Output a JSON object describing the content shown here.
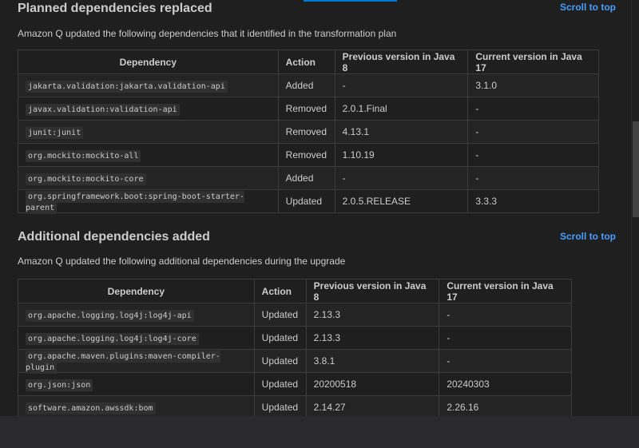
{
  "planned": {
    "title": "Planned dependencies replaced",
    "scroll_label": "Scroll to top",
    "description": "Amazon Q updated the following dependencies that it identified in the transformation plan",
    "columns": [
      "Dependency",
      "Action",
      "Previous version in Java 8",
      "Current version in Java 17"
    ],
    "rows": [
      [
        "jakarta.validation:jakarta.validation-api",
        "Added",
        "-",
        "3.1.0"
      ],
      [
        "javax.validation:validation-api",
        "Removed",
        "2.0.1.Final",
        "-"
      ],
      [
        "junit:junit",
        "Removed",
        "4.13.1",
        "-"
      ],
      [
        "org.mockito:mockito-all",
        "Removed",
        "1.10.19",
        "-"
      ],
      [
        "org.mockito:mockito-core",
        "Added",
        "-",
        "-"
      ],
      [
        "org.springframework.boot:spring-boot-starter-parent",
        "Updated",
        "2.0.5.RELEASE",
        "3.3.3"
      ]
    ]
  },
  "additional": {
    "title": "Additional dependencies added",
    "scroll_label": "Scroll to top",
    "description": "Amazon Q updated the following additional dependencies during the upgrade",
    "columns": [
      "Dependency",
      "Action",
      "Previous version in Java 8",
      "Current version in Java 17"
    ],
    "rows": [
      [
        "org.apache.logging.log4j:log4j-api",
        "Updated",
        "2.13.3",
        "-"
      ],
      [
        "org.apache.logging.log4j:log4j-core",
        "Updated",
        "2.13.3",
        "-"
      ],
      [
        "org.apache.maven.plugins:maven-compiler-plugin",
        "Updated",
        "3.8.1",
        "-"
      ],
      [
        "org.json:json",
        "Updated",
        "20200518",
        "20240303"
      ],
      [
        "software.amazon.awssdk:bom",
        "Updated",
        "2.14.27",
        "2.26.16"
      ]
    ]
  },
  "colors": {
    "link": "#4a9eff",
    "accent": "#0078d4",
    "background": "#1f1f1f"
  }
}
